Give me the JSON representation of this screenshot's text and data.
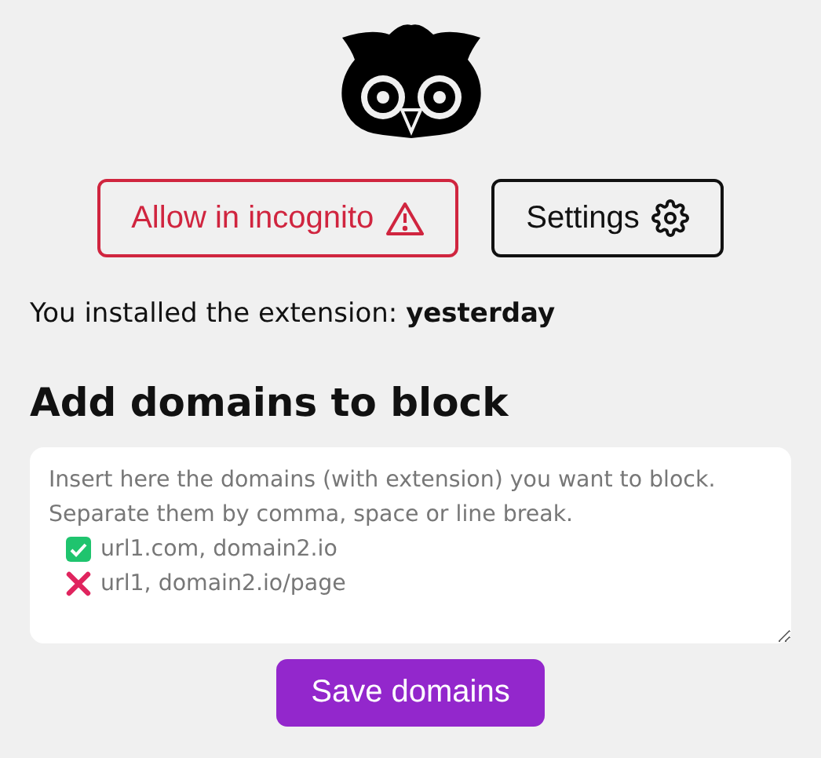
{
  "header": {
    "buttons": [
      {
        "kind": "warning",
        "label": "Allow in incognito"
      },
      {
        "kind": "settings",
        "label": "Settings"
      }
    ]
  },
  "install_info": {
    "label": "You installed the extension:",
    "value": "yesterday"
  },
  "section": {
    "title": "Add domains to block"
  },
  "domains_field": {
    "hint_lines": [
      "Insert here the domains (with extension) you want to block.",
      "Separate them by comma, space or line break."
    ],
    "examples": [
      {
        "kind": "valid",
        "text": "url1.com, domain2.io"
      },
      {
        "kind": "invalid",
        "text": "url1, domain2.io/page"
      }
    ]
  },
  "save_button": {
    "label": "Save domains"
  }
}
